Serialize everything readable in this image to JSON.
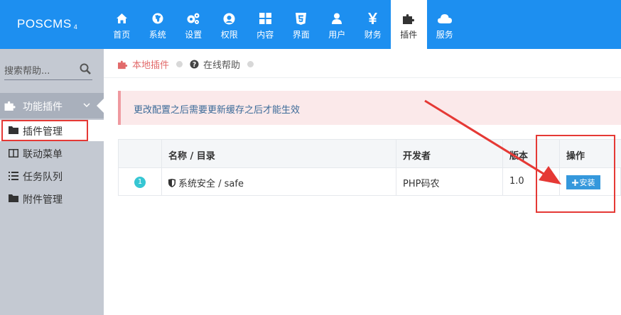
{
  "brand": {
    "name": "POSCMS",
    "version": "4"
  },
  "nav": [
    {
      "label": "首页",
      "icon": "home-icon"
    },
    {
      "label": "系统",
      "icon": "globe-icon"
    },
    {
      "label": "设置",
      "icon": "cogs-icon"
    },
    {
      "label": "权限",
      "icon": "user-circle-icon"
    },
    {
      "label": "内容",
      "icon": "grid-icon"
    },
    {
      "label": "界面",
      "icon": "html5-icon"
    },
    {
      "label": "用户",
      "icon": "user-icon"
    },
    {
      "label": "财务",
      "icon": "yen-icon"
    },
    {
      "label": "插件",
      "icon": "puzzle-icon",
      "active": true
    },
    {
      "label": "服务",
      "icon": "cloud-icon"
    }
  ],
  "sidebar": {
    "search_placeholder": "搜索帮助...",
    "group_label": "功能插件",
    "items": [
      {
        "label": "插件管理",
        "icon": "folder-icon",
        "active": true
      },
      {
        "label": "联动菜单",
        "icon": "columns-icon"
      },
      {
        "label": "任务队列",
        "icon": "list-icon"
      },
      {
        "label": "附件管理",
        "icon": "folder-icon"
      }
    ]
  },
  "breadcrumb": {
    "local": "本地插件",
    "help": "在线帮助"
  },
  "alert": {
    "text": "更改配置之后需要更新缓存之后才能生效"
  },
  "table": {
    "headers": {
      "name": "名称 / 目录",
      "developer": "开发者",
      "version": "版本",
      "action": "操作"
    },
    "rows": [
      {
        "index": "1",
        "name": "系统安全 / safe",
        "developer": "PHP码农",
        "version": "1.0",
        "action": "安装"
      }
    ]
  },
  "colors": {
    "topbar": "#1d8ff0",
    "sidebar": "#c4c9d2",
    "accent": "#3598dc",
    "annotation": "#e53935"
  }
}
